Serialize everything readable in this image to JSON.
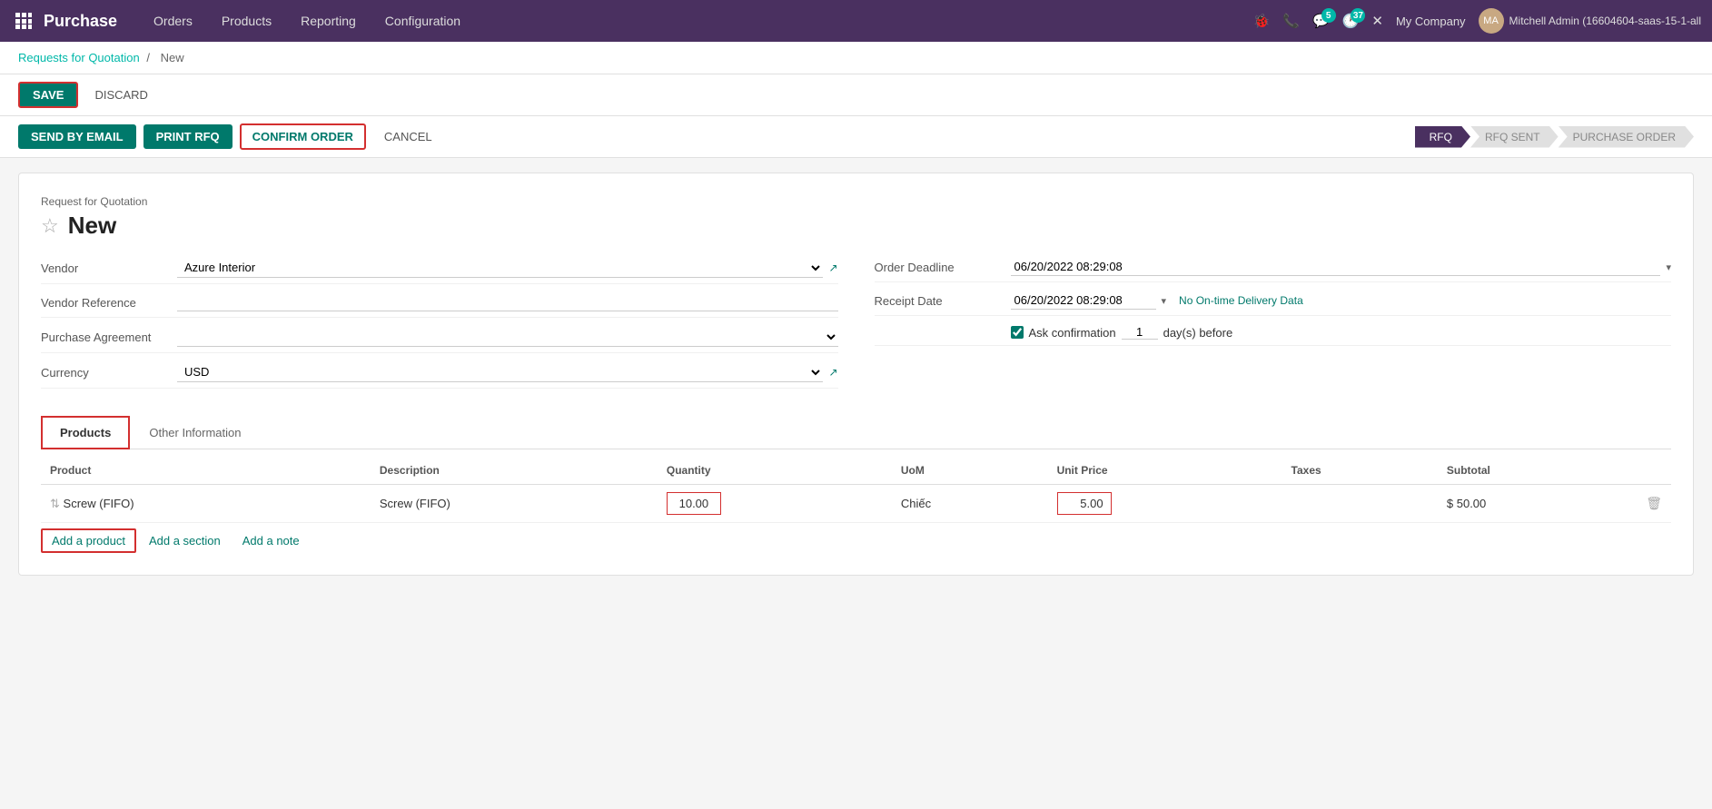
{
  "nav": {
    "brand": "Purchase",
    "links": [
      "Orders",
      "Products",
      "Reporting",
      "Configuration"
    ],
    "company": "My Company",
    "user": "Mitchell Admin (16604604-saas-15-1-all",
    "badge_chat": "5",
    "badge_clock": "37"
  },
  "breadcrumb": {
    "parent": "Requests for Quotation",
    "separator": "/",
    "current": "New"
  },
  "actions": {
    "save_label": "SAVE",
    "discard_label": "DISCARD",
    "send_email_label": "SEND BY EMAIL",
    "print_rfq_label": "PRINT RFQ",
    "confirm_order_label": "CONFIRM ORDER",
    "cancel_label": "CANCEL"
  },
  "pipeline": {
    "steps": [
      {
        "label": "RFQ",
        "active": true
      },
      {
        "label": "RFQ SENT",
        "active": false
      },
      {
        "label": "PURCHASE ORDER",
        "active": false
      }
    ]
  },
  "form": {
    "title_label": "Request for Quotation",
    "title": "New",
    "fields_left": [
      {
        "label": "Vendor",
        "value": "Azure Interior",
        "type": "select",
        "has_external": true
      },
      {
        "label": "Vendor Reference",
        "value": "",
        "type": "input"
      },
      {
        "label": "Purchase Agreement",
        "value": "",
        "type": "select"
      },
      {
        "label": "Currency",
        "value": "USD",
        "type": "select",
        "has_external": true
      }
    ],
    "fields_right": [
      {
        "label": "Order Deadline",
        "value": "06/20/2022 08:29:08",
        "type": "date_select"
      },
      {
        "label": "Receipt Date",
        "value": "06/20/2022 08:29:08",
        "type": "date",
        "extra": "No On-time Delivery Data"
      }
    ],
    "ask_confirmation": {
      "label": "Ask confirmation",
      "days": "1",
      "suffix": "day(s) before",
      "checked": true
    }
  },
  "tabs": [
    {
      "label": "Products",
      "active": true
    },
    {
      "label": "Other Information",
      "active": false
    }
  ],
  "table": {
    "columns": [
      "Product",
      "Description",
      "Quantity",
      "UoM",
      "Unit Price",
      "Taxes",
      "Subtotal"
    ],
    "rows": [
      {
        "product": "Screw (FIFO)",
        "description": "Screw (FIFO)",
        "quantity": "10.00",
        "uom": "Chiếc",
        "unit_price": "5.00",
        "taxes": "",
        "subtotal": "$ 50.00"
      }
    ],
    "add_product_label": "Add a product",
    "add_section_label": "Add a section",
    "add_note_label": "Add a note"
  }
}
